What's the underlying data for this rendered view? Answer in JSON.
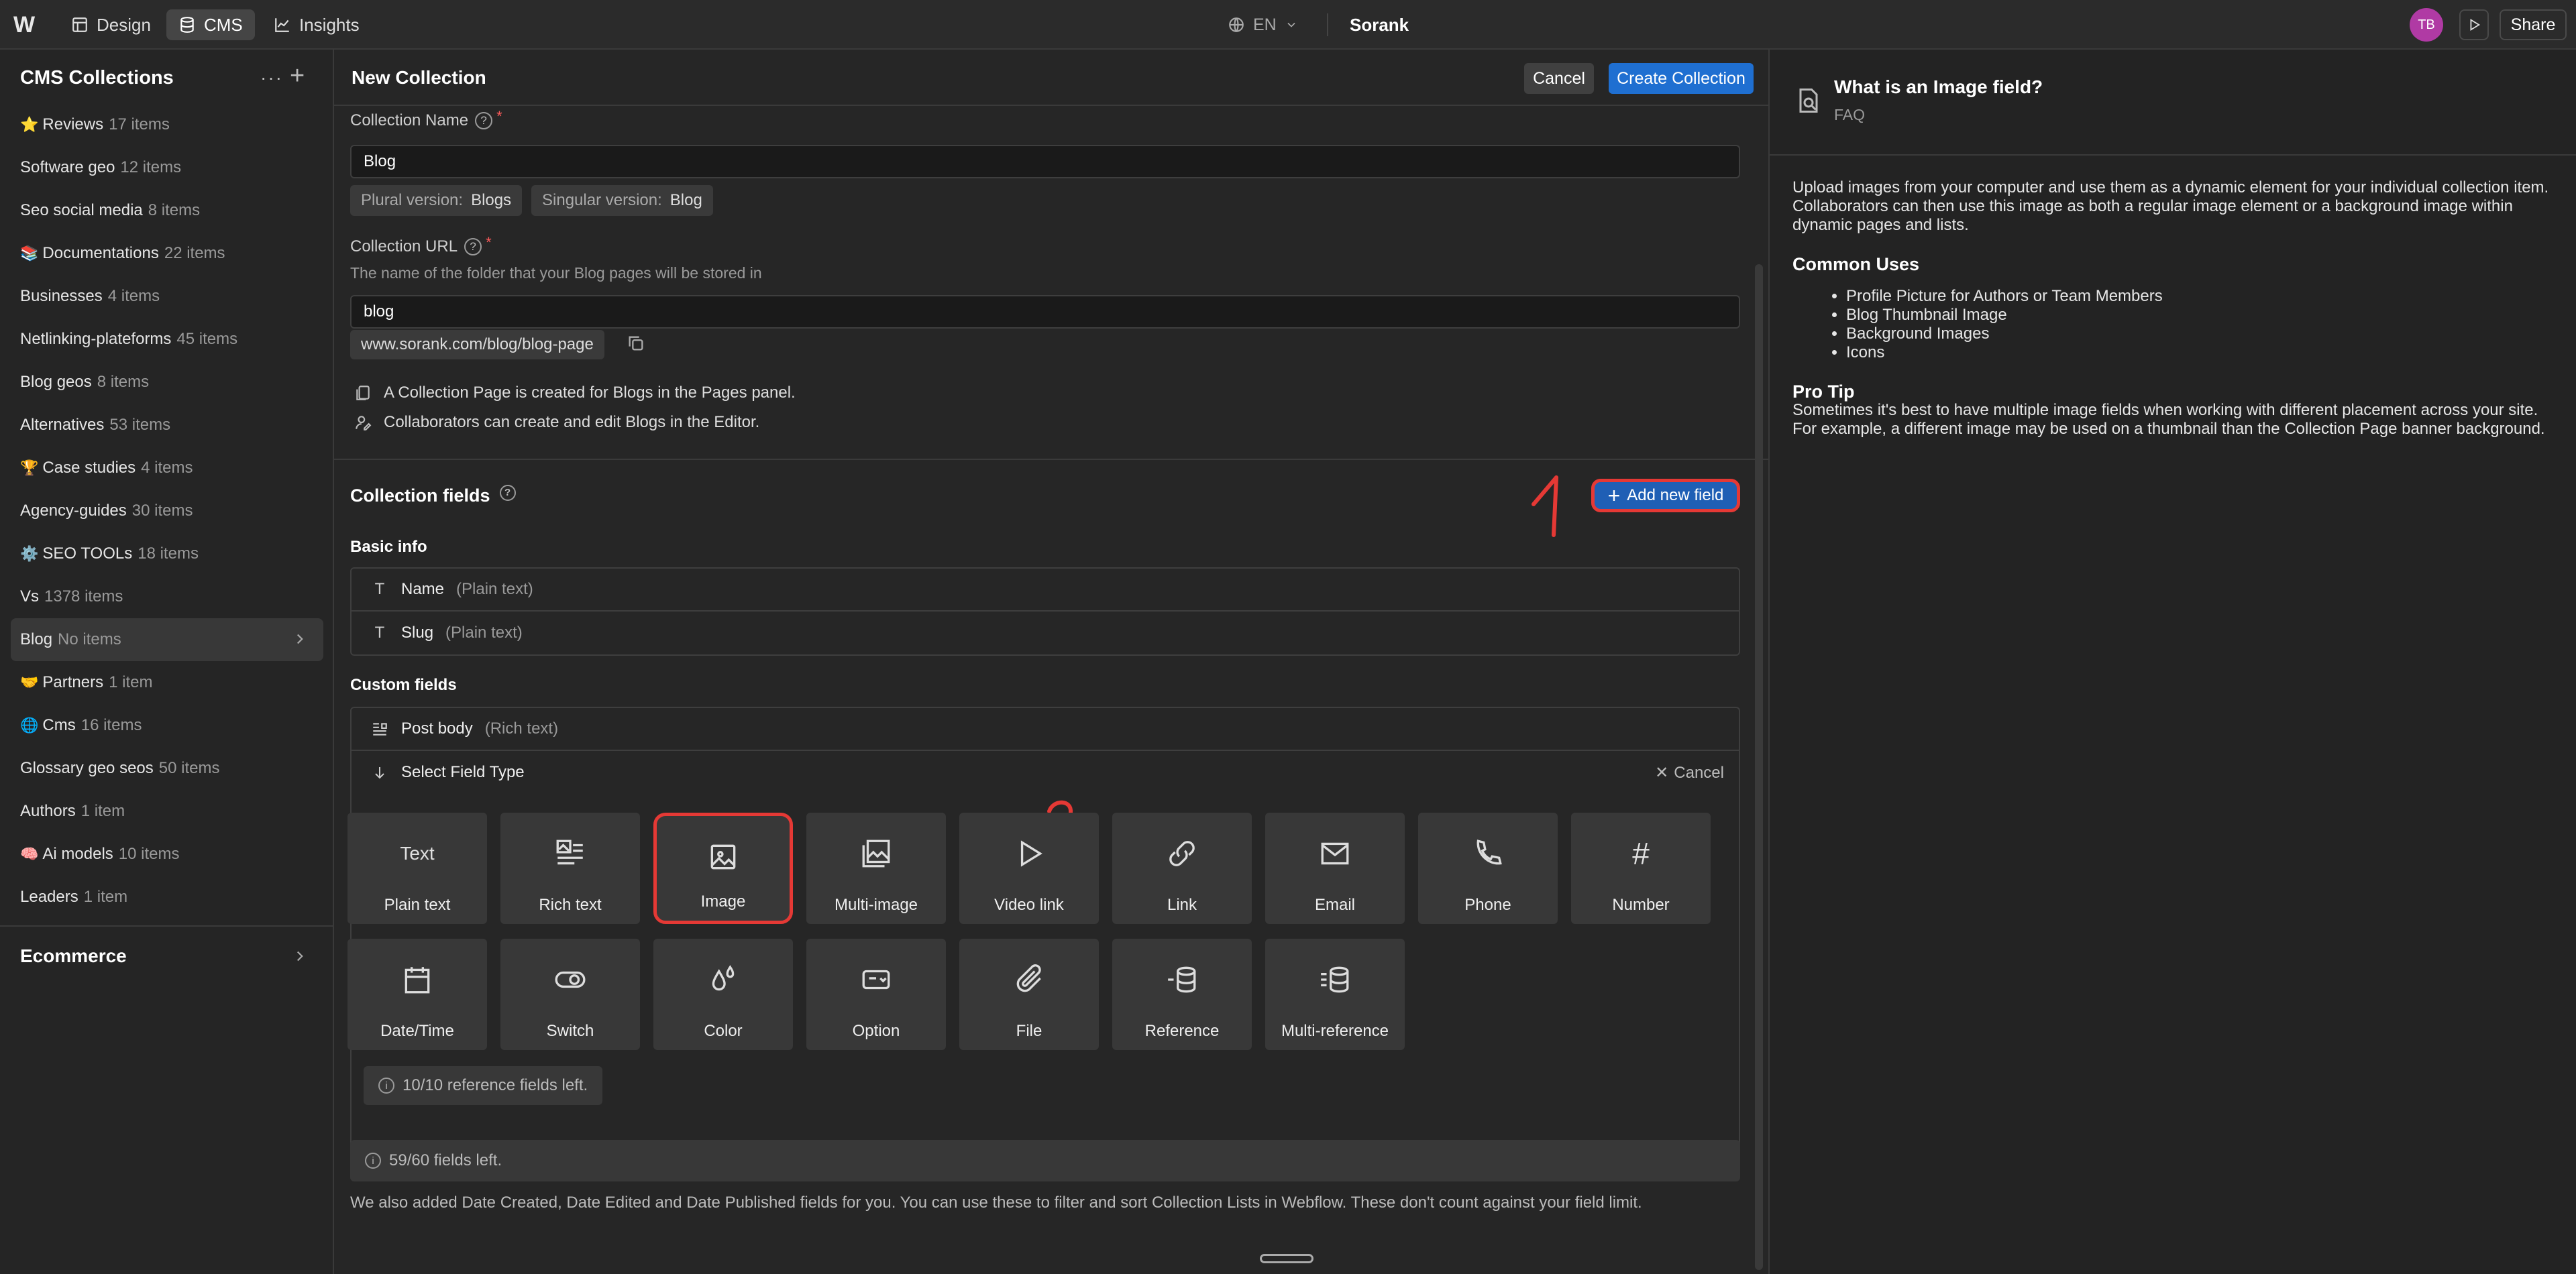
{
  "topbar": {
    "logo": "W",
    "tabs": [
      {
        "label": "Design",
        "icon": "design-icon"
      },
      {
        "label": "CMS",
        "icon": "database-icon"
      },
      {
        "label": "Insights",
        "icon": "chart-icon"
      }
    ],
    "language": "EN",
    "site_name": "Sorank",
    "avatar_initials": "TB",
    "share_label": "Share"
  },
  "sidebar": {
    "title": "CMS Collections",
    "more_label": "···",
    "add_label": "+",
    "items": [
      {
        "emoji": "⭐",
        "name": "Reviews",
        "count": "17 items"
      },
      {
        "emoji": "",
        "name": "Software geo",
        "count": "12 items"
      },
      {
        "emoji": "",
        "name": "Seo social media",
        "count": "8 items"
      },
      {
        "emoji": "📚",
        "name": "Documentations",
        "count": "22 items"
      },
      {
        "emoji": "",
        "name": "Businesses",
        "count": "4 items"
      },
      {
        "emoji": "",
        "name": "Netlinking-plateforms",
        "count": "45 items"
      },
      {
        "emoji": "",
        "name": "Blog geos",
        "count": "8 items"
      },
      {
        "emoji": "",
        "name": "Alternatives",
        "count": "53 items"
      },
      {
        "emoji": "🏆",
        "name": "Case studies",
        "count": "4 items"
      },
      {
        "emoji": "",
        "name": "Agency-guides",
        "count": "30 items"
      },
      {
        "emoji": "⚙️",
        "name": "SEO TOOLs",
        "count": "18 items"
      },
      {
        "emoji": "",
        "name": "Vs",
        "count": "1378 items"
      },
      {
        "emoji": "",
        "name": "Blog",
        "count": "No items"
      },
      {
        "emoji": "🤝",
        "name": "Partners",
        "count": "1 item"
      },
      {
        "emoji": "🌐",
        "name": "Cms",
        "count": "16 items"
      },
      {
        "emoji": "",
        "name": "Glossary geo seos",
        "count": "50 items"
      },
      {
        "emoji": "",
        "name": "Authors",
        "count": "1 item"
      },
      {
        "emoji": "🧠",
        "name": "Ai models",
        "count": "10 items"
      },
      {
        "emoji": "",
        "name": "Leaders",
        "count": "1 item"
      }
    ],
    "ecommerce_label": "Ecommerce"
  },
  "main": {
    "title": "New Collection",
    "cancel_label": "Cancel",
    "create_label": "Create Collection",
    "collection_name_label": "Collection Name",
    "required_mark": "*",
    "help_mark": "?",
    "collection_name_value": "Blog",
    "plural_label": "Plural version:",
    "plural_value": "Blogs",
    "singular_label": "Singular version:",
    "singular_value": "Blog",
    "collection_url_label": "Collection URL",
    "collection_url_hint": "The name of the folder that your Blog pages will be stored in",
    "collection_url_value": "blog",
    "url_preview": "www.sorank.com/blog/blog-page",
    "info_page": "A Collection Page is created for Blogs in the Pages panel.",
    "info_editor": "Collaborators can create and edit Blogs in the Editor.",
    "fields_title": "Collection fields",
    "add_field_label": "Add new field",
    "basic_info_title": "Basic info",
    "basic_fields": [
      {
        "name": "Name",
        "type": "(Plain text)"
      },
      {
        "name": "Slug",
        "type": "(Plain text)"
      }
    ],
    "custom_fields_title": "Custom fields",
    "custom_fields": [
      {
        "name": "Post body",
        "type": "(Rich text)"
      }
    ],
    "select_type_label": "Select Field Type",
    "select_cancel_label": "Cancel",
    "field_types": [
      {
        "name": "Plain text",
        "icon": "text-icon",
        "glyph": "Text"
      },
      {
        "name": "Rich text",
        "icon": "rich-text-icon",
        "glyph": ""
      },
      {
        "name": "Image",
        "icon": "image-icon",
        "glyph": ""
      },
      {
        "name": "Multi-image",
        "icon": "multi-image-icon",
        "glyph": ""
      },
      {
        "name": "Video link",
        "icon": "play-icon",
        "glyph": ""
      },
      {
        "name": "Link",
        "icon": "link-icon",
        "glyph": ""
      },
      {
        "name": "Email",
        "icon": "email-icon",
        "glyph": ""
      },
      {
        "name": "Phone",
        "icon": "phone-icon",
        "glyph": ""
      },
      {
        "name": "Number",
        "icon": "hash-icon",
        "glyph": "#"
      },
      {
        "name": "Date/Time",
        "icon": "calendar-icon",
        "glyph": ""
      },
      {
        "name": "Switch",
        "icon": "switch-icon",
        "glyph": ""
      },
      {
        "name": "Color",
        "icon": "color-drop-icon",
        "glyph": ""
      },
      {
        "name": "Option",
        "icon": "option-icon",
        "glyph": ""
      },
      {
        "name": "File",
        "icon": "paperclip-icon",
        "glyph": ""
      },
      {
        "name": "Reference",
        "icon": "reference-icon",
        "glyph": ""
      },
      {
        "name": "Multi-reference",
        "icon": "multi-reference-icon",
        "glyph": ""
      }
    ],
    "reference_left": "10/10 reference fields left.",
    "fields_left": "59/60 fields left.",
    "footer_note": "We also added Date Created, Date Edited and Date Published fields for you. You can use these to filter and sort Collection Lists in Webflow. These don't count against your field limit.",
    "annotation_1": "1",
    "annotation_2": "2",
    "accent_color": "#1f6fd1",
    "annotation_color": "#e53935"
  },
  "help_panel": {
    "title": "What is an Image field?",
    "subtitle": "FAQ",
    "intro": "Upload images from your computer and use them as a dynamic element for your individual collection item. Collaborators can then use this image as both a regular image element or a background image within dynamic pages and lists.",
    "uses_title": "Common Uses",
    "uses": [
      "Profile Picture for Authors or Team Members",
      "Blog Thumbnail Image",
      "Background Images",
      "Icons"
    ],
    "tip_title": "Pro Tip",
    "tip": "Sometimes it's best to have multiple image fields when working with different placement across your site. For example, a different image may be used on a thumbnail than the Collection Page banner background."
  }
}
